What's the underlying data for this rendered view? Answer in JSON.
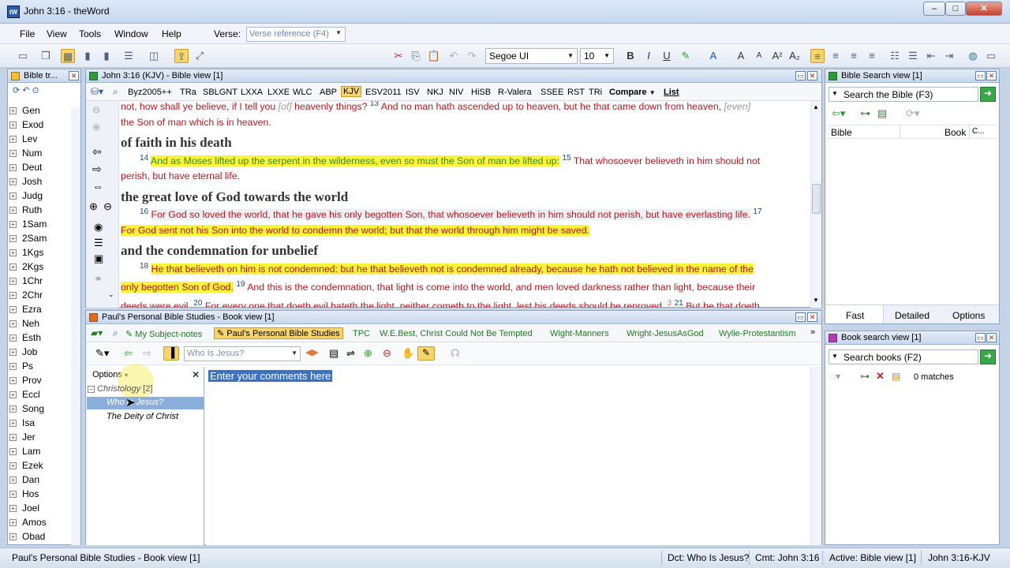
{
  "window": {
    "title": "John 3:16 - theWord",
    "app_icon": "tW",
    "min": "–",
    "max": "□",
    "close": "✕"
  },
  "menu": {
    "items": [
      "File",
      "View",
      "Tools",
      "Window",
      "Help"
    ],
    "verse_label": "Verse:",
    "verse_placeholder": "Verse reference (F4)"
  },
  "toolbar": {
    "font": "Segoe UI",
    "size": "10",
    "bold": "B",
    "italic": "I",
    "underline": "U",
    "grow": "A",
    "shrink": "A"
  },
  "book_tree": {
    "title": "Bible tr...",
    "books": [
      "Gen",
      "Exod",
      "Lev",
      "Num",
      "Deut",
      "Josh",
      "Judg",
      "Ruth",
      "1Sam",
      "2Sam",
      "1Kgs",
      "2Kgs",
      "1Chr",
      "2Chr",
      "Ezra",
      "Neh",
      "Esth",
      "Job",
      "Ps",
      "Prov",
      "Eccl",
      "Song",
      "Isa",
      "Jer",
      "Lam",
      "Ezek",
      "Dan",
      "Hos",
      "Joel",
      "Amos",
      "Obad"
    ]
  },
  "bible": {
    "title": "John 3:16 (KJV) - Bible view [1]",
    "translations": [
      "Byz2005++",
      "TRa",
      "SBLGNT",
      "LXXA",
      "LXXE",
      "WLC",
      "ABP",
      "KJV",
      "ESV2011",
      "ISV",
      "NKJ",
      "NIV",
      "HiSB",
      "R-Valera",
      "SSEE",
      "RST",
      "TRi"
    ],
    "compare": "Compare",
    "list": "List",
    "line1": "not, how shall ye believe, if I tell you",
    "line1_it": "[of]",
    "line1_b": "heavenly things?",
    "v13n": "13",
    "v13": "And no man hath ascended up to heaven, but he that came down from heaven,",
    "v13_it": "[even]",
    "line2": "the Son of man which is in heaven.",
    "h1": "of faith in his death",
    "v14n": "14",
    "v14": "And as Moses lifted up the serpent in the wilderness, even so must the Son of man be lifted up:",
    "v15n": "15",
    "v15a": "That whosoever believeth in him should not",
    "v15b": "perish, but have eternal life.",
    "h2": "the great love of God towards the world",
    "v16n": "16",
    "v16": "For God so loved the world, that he gave his only begotten Son, that whosoever believeth in him should not perish, but have everlasting life.",
    "v17n": "17",
    "v17": "For God sent not his Son into the world to condemn the world; but that the world through him might be saved.",
    "h3": "and the condemnation for unbelief",
    "v18n": "18",
    "v18a": "He that believeth on him is not condemned: but he that believeth not is condemned already, because he hath not believed in the name of the",
    "v18b": "only begotten Son of God.",
    "v19n": "19",
    "v19": "And this is the condemnation, that light is come into the world, and men loved darkness rather than light, because their",
    "v20a": "deeds were evil.",
    "v20n": "20",
    "v20": "For every one that doeth evil hateth the light, neither cometh to the light, lest his deeds should be reproved.",
    "fn": "3",
    "v21n": "21",
    "v21": "But he that doeth"
  },
  "book": {
    "title": "Paul's Personal Bible Studies - Book view [1]",
    "tabs": [
      "My Subject-notes",
      "Paul's Personal Bible Studies",
      "TPC",
      "W.E.Best, Christ Could Not Be Tempted",
      "Wight-Manners",
      "Wright-JesusAsGod",
      "Wylie-Protestantism"
    ],
    "topic_placeholder": "Who Is Jesus?",
    "options": "Options",
    "tree": {
      "parent": "Christology",
      "count": "[2]",
      "child1": "Who Is Jesus?",
      "child2": "The Deity of Christ"
    },
    "editor_text": "Enter your comments here"
  },
  "search": {
    "title": "Bible Search view [1]",
    "placeholder": "Search the Bible (F3)",
    "col_bible": "Bible",
    "col_book": "Book",
    "col_c": "C...",
    "tabs": [
      "Fast",
      "Detailed",
      "Options"
    ]
  },
  "book_search": {
    "title": "Book search view [1]",
    "placeholder": "Search books (F2)",
    "matches": "0 matches"
  },
  "status": {
    "left": "Paul's Personal Bible Studies - Book view [1]",
    "dct": "Dct: Who Is Jesus?",
    "cmt": "Cmt: John 3:16",
    "active": "Active: Bible view [1]",
    "ref": "John 3:16-KJV"
  }
}
